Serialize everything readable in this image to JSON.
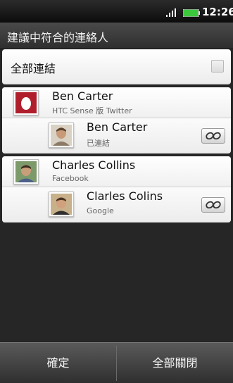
{
  "status_bar": {
    "time": "12:26",
    "signal_icon": "signal-bars-icon",
    "battery_icon": "battery-icon"
  },
  "header": {
    "title": "建議中符合的連絡人"
  },
  "link_all": {
    "label": "全部連結",
    "checked": false
  },
  "groups": [
    {
      "primary": {
        "name": "Ben Carter",
        "source": "HTC Sense 版 Twitter",
        "avatar_icon": "egg-avatar-icon"
      },
      "suggestion": {
        "name": "Ben Carter",
        "source": "已連結",
        "avatar_icon": "person-photo-icon",
        "action_icon": "link-icon"
      }
    },
    {
      "primary": {
        "name": "Charles Collins",
        "source": "Facebook",
        "avatar_icon": "person-photo-icon"
      },
      "suggestion": {
        "name": "Clarles Colins",
        "source": "Google",
        "avatar_icon": "person-photo-icon",
        "action_icon": "link-icon"
      }
    }
  ],
  "bottom_bar": {
    "confirm_label": "確定",
    "close_all_label": "全部關閉"
  },
  "colors": {
    "accent_green": "#3cc83c",
    "background": "#1c1c1c"
  }
}
